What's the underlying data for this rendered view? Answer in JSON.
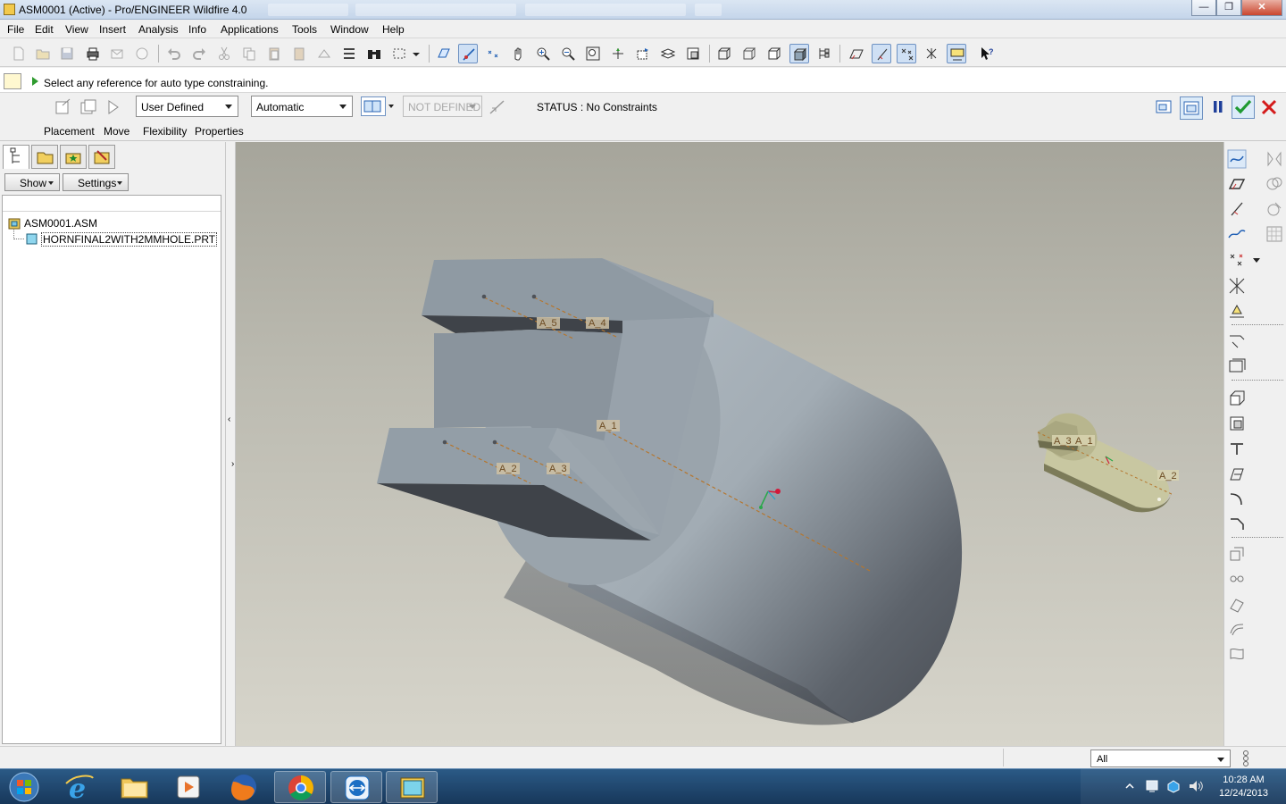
{
  "window": {
    "title": "ASM0001 (Active) - Pro/ENGINEER Wildfire 4.0",
    "minimize": "—",
    "restore": "❐",
    "close": "✕"
  },
  "menu": [
    "File",
    "Edit",
    "View",
    "Insert",
    "Analysis",
    "Info",
    "Applications",
    "Tools",
    "Window",
    "Help"
  ],
  "message": "Select any reference for auto type constraining.",
  "dashboard": {
    "constraint_set": "User Defined",
    "constraint_type": "Automatic",
    "offset": "NOT DEFINED",
    "status": "STATUS : No Constraints",
    "tabs": [
      "Placement",
      "Move",
      "Flexibility",
      "Properties"
    ]
  },
  "model_tree": {
    "show_button": "Show",
    "settings_button": "Settings",
    "items": [
      {
        "label": "ASM0001.ASM",
        "level": 0
      },
      {
        "label": "HORNFINAL2WITH2MMHOLE.PRT",
        "level": 1
      }
    ]
  },
  "viewport": {
    "axes_large": [
      "A_5",
      "A_4",
      "A_1",
      "A_2",
      "A_3"
    ],
    "axes_small": [
      "A_3",
      "A_1",
      "A_2"
    ],
    "colors": {
      "part_face": "#a9b3bb",
      "part_dark": "#4a4e55",
      "small_part": "#c8c7a1",
      "axis": "#b5762e"
    }
  },
  "filter": {
    "value": "All"
  },
  "clock": {
    "time": "10:28 AM",
    "date": "12/24/2013"
  }
}
